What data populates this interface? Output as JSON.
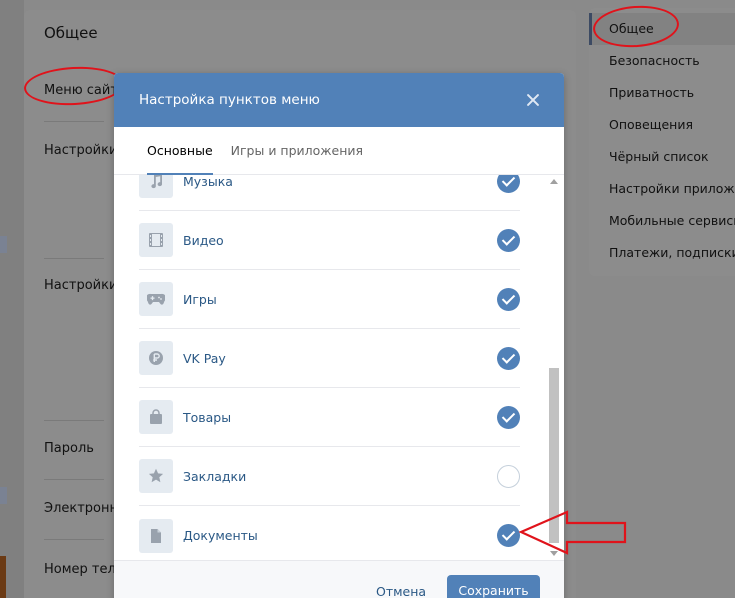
{
  "background": {
    "section_title": "Общее",
    "rows": [
      {
        "label": "Меню сайта"
      },
      {
        "label": "Настройки"
      },
      {
        "label": "Настройки"
      },
      {
        "label": "Пароль"
      },
      {
        "label": "Электронная"
      },
      {
        "label": "Номер теле"
      }
    ],
    "right_menu": [
      {
        "label": "Общее",
        "active": true
      },
      {
        "label": "Безопасность"
      },
      {
        "label": "Приватность"
      },
      {
        "label": "Оповещения"
      },
      {
        "label": "Чёрный список"
      },
      {
        "label": "Настройки приложений"
      },
      {
        "label": "Мобильные сервисы"
      },
      {
        "label": "Платежи, подписки, переводы"
      }
    ]
  },
  "modal": {
    "title": "Настройка пунктов меню",
    "tabs": [
      {
        "label": "Основные",
        "active": true
      },
      {
        "label": "Игры и приложения",
        "active": false
      }
    ],
    "items": [
      {
        "label": "Музыка",
        "icon": "music-note-icon",
        "checked": true
      },
      {
        "label": "Видео",
        "icon": "film-icon",
        "checked": true
      },
      {
        "label": "Игры",
        "icon": "gamepad-icon",
        "checked": true
      },
      {
        "label": "VK Pay",
        "icon": "ruble-coin-icon",
        "checked": true
      },
      {
        "label": "Товары",
        "icon": "shopping-bag-icon",
        "checked": true
      },
      {
        "label": "Закладки",
        "icon": "star-icon",
        "checked": false
      },
      {
        "label": "Документы",
        "icon": "document-icon",
        "checked": true
      }
    ],
    "cancel_label": "Отмена",
    "save_label": "Сохранить"
  },
  "colors": {
    "accent": "#5181b8",
    "link": "#2a5885",
    "annotation": "#e0131b"
  }
}
